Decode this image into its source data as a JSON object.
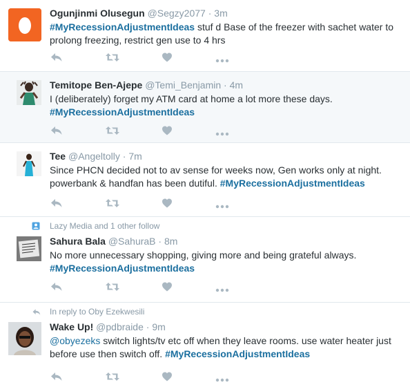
{
  "colors": {
    "accent": "#1b6f9f",
    "muted": "#8899a6",
    "icon": "#aab8c2",
    "highlight_bg": "#f5f8fa"
  },
  "tweets": [
    {
      "name": "Ogunjinmi Olusegun",
      "handle": "@Segzy2077",
      "dot": "·",
      "time": "3m",
      "hashtag": "#MyRecessionAdjustmentIdeas",
      "text_after": " stuf d Base of the freezer with sachet water to prolong freezing, restrict gen use to 4 hrs",
      "avatar": "egg-avatar"
    },
    {
      "name": "Temitope Ben-Ajepe",
      "handle": "@Temi_Benjamin",
      "dot": "·",
      "time": "4m",
      "text_before": "I (deliberately) forget my ATM card at home a lot more these days.",
      "hashtag": "#MyRecessionAdjustmentIdeas",
      "avatar": "person-avatar"
    },
    {
      "name": "Tee",
      "handle": "@Angeltolly",
      "dot": "·",
      "time": "7m",
      "text_before": "Since PHCN decided not to av sense for weeks now, Gen works only at night. powerbank & handfan has been dutiful. ",
      "hashtag": "#MyRecessionAdjustmentIdeas",
      "avatar": "person-avatar"
    },
    {
      "context": "Lazy Media and 1 other follow",
      "name": "Sahura Bala",
      "handle": "@SahuraB",
      "dot": "·",
      "time": "8m",
      "text_before": "No more unnecessary shopping, giving more and being grateful always.",
      "hashtag": "#MyRecessionAdjustmentIdeas",
      "avatar": "photo-avatar"
    },
    {
      "context": "In reply to Oby Ezekwesili",
      "name": "Wake Up!",
      "handle": "@pdbraide",
      "dot": "·",
      "time": "9m",
      "mention": "@obyezeks",
      "text_before": " switch lights/tv etc off when they leave rooms. use water heater just before use then switch off. ",
      "hashtag": "#MyRecessionAdjustmentIdeas",
      "avatar": "person-avatar"
    }
  ]
}
